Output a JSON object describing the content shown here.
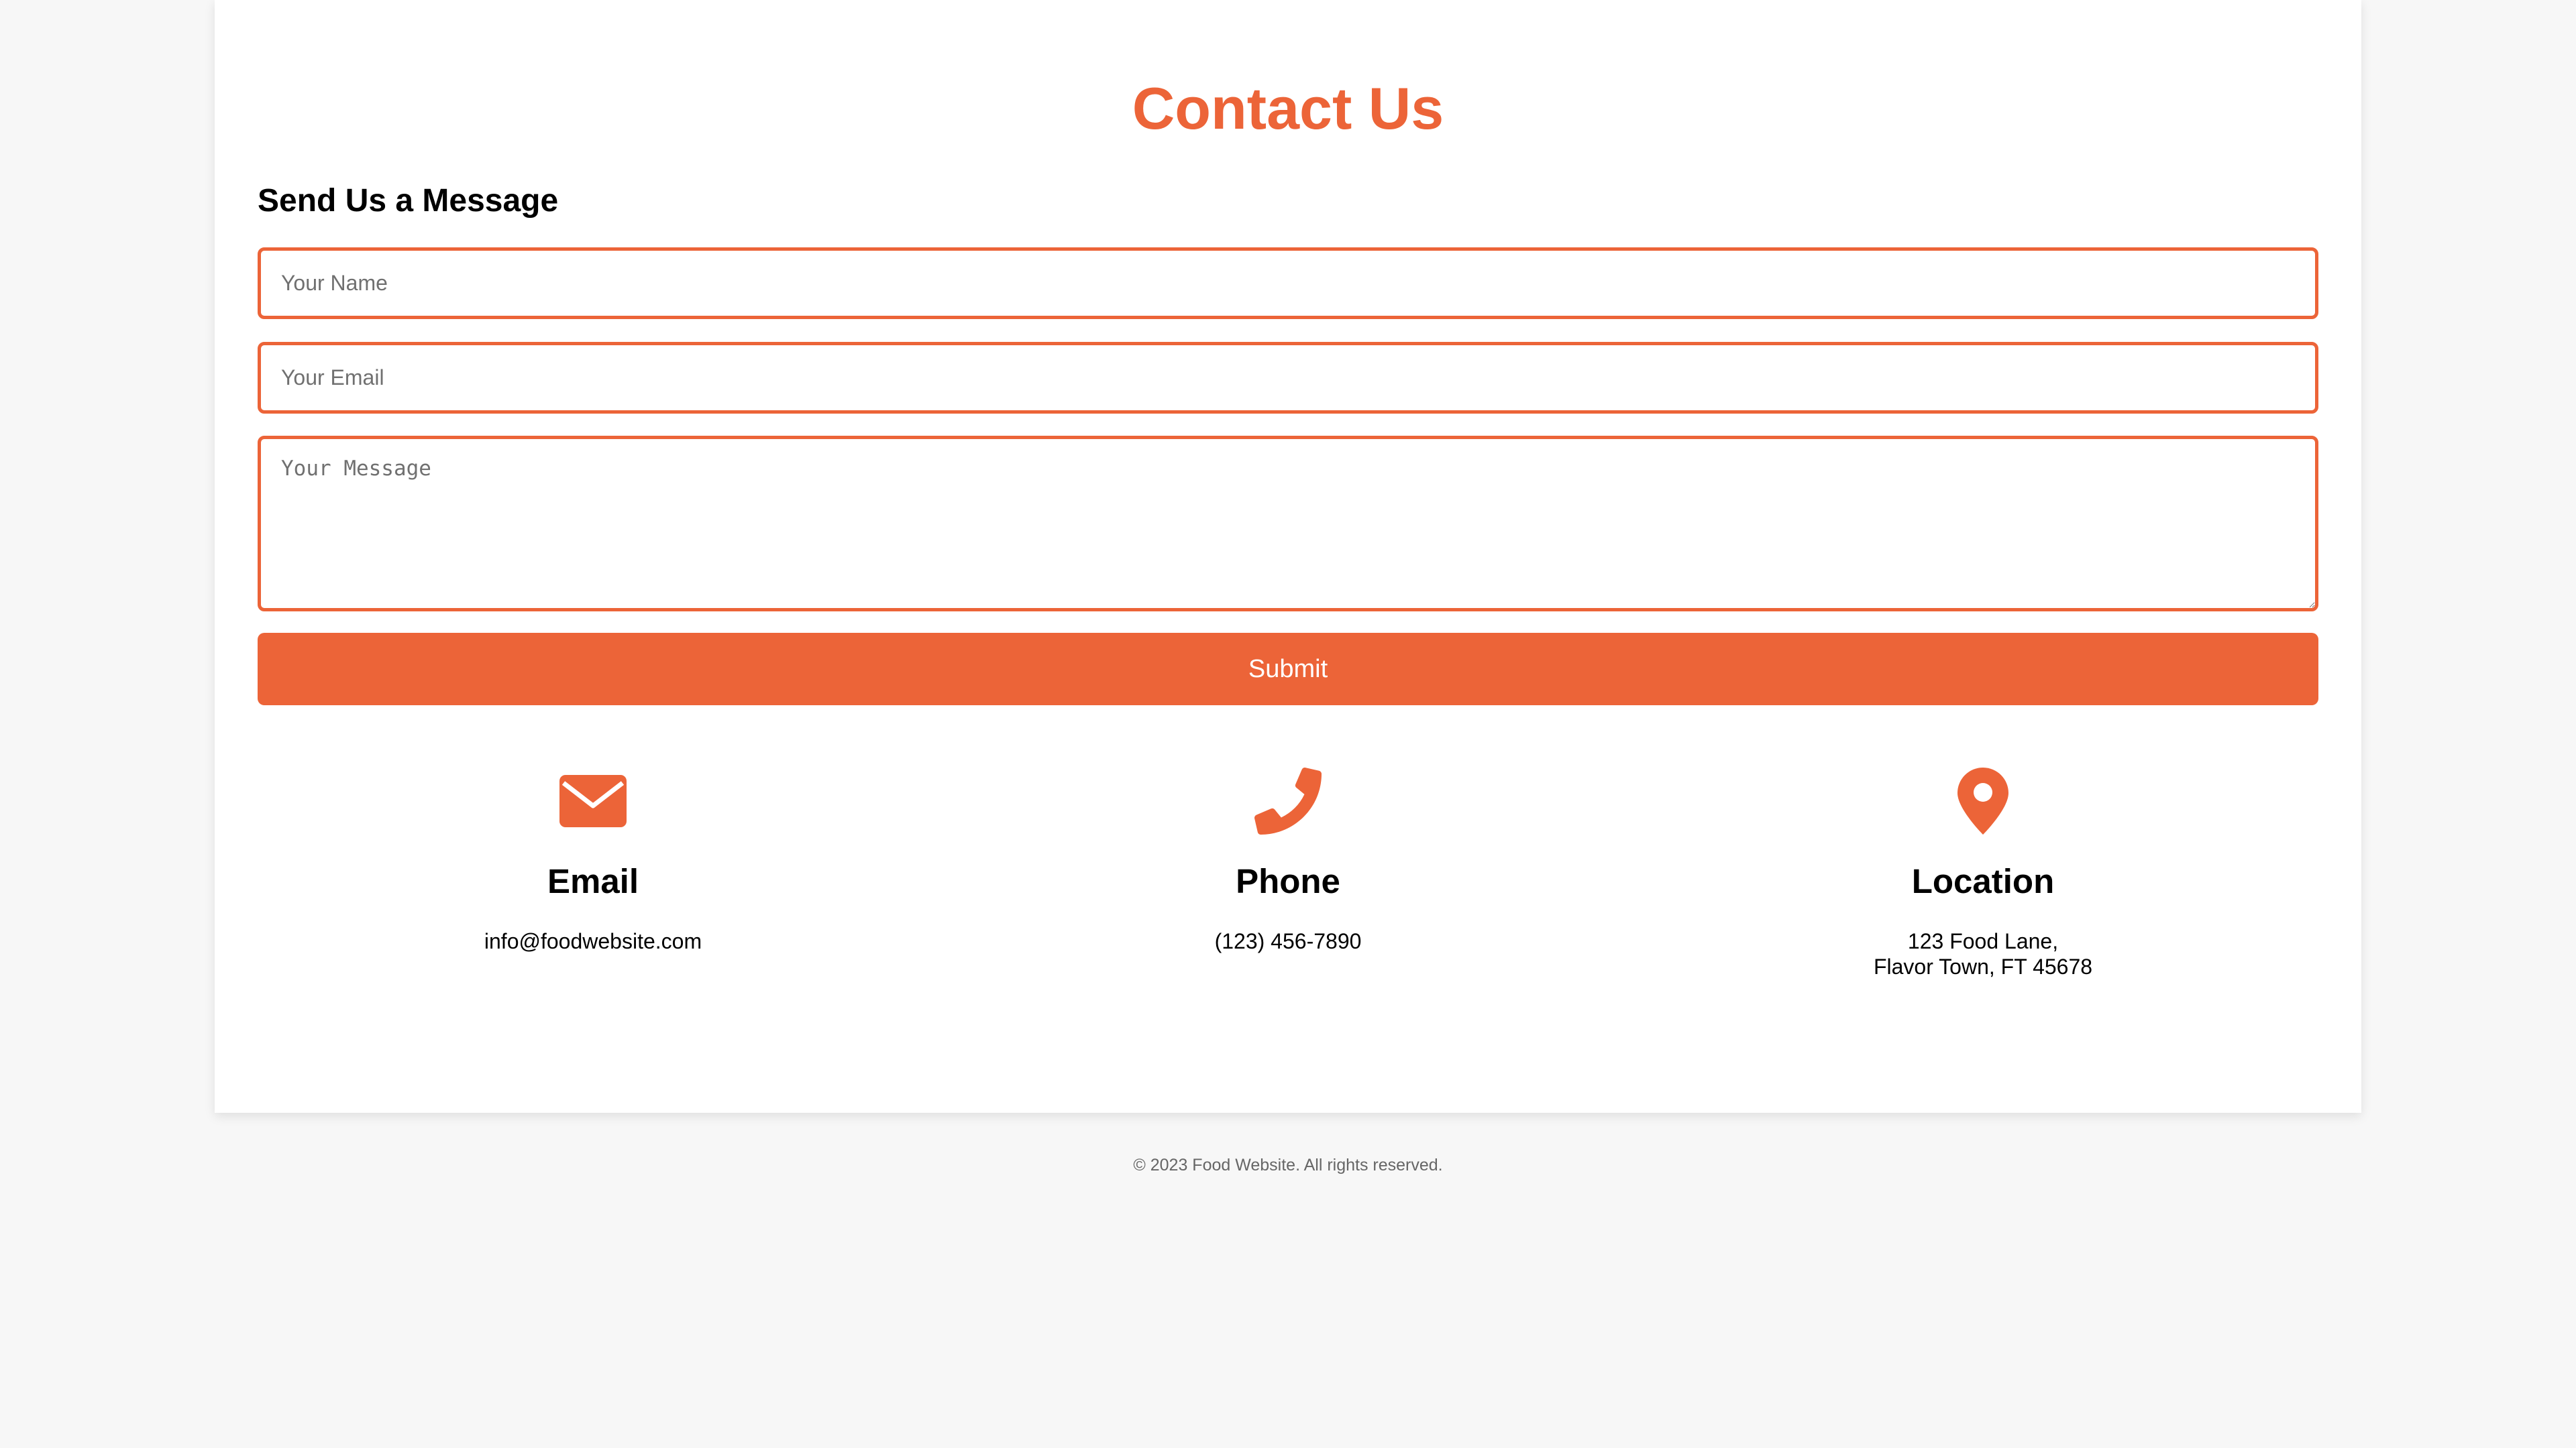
{
  "page": {
    "title": "Contact Us",
    "accent_color": "#ec6438",
    "background_color": "#f7f7f7"
  },
  "form": {
    "heading": "Send Us a Message",
    "name_placeholder": "Your Name",
    "email_placeholder": "Your Email",
    "message_placeholder": "Your Message",
    "name_value": "",
    "email_value": "",
    "message_value": "",
    "submit_label": "Submit"
  },
  "contact_info": {
    "email": {
      "icon": "envelope-icon",
      "title": "Email",
      "text": "info@foodwebsite.com"
    },
    "phone": {
      "icon": "phone-icon",
      "title": "Phone",
      "text": "(123) 456-7890"
    },
    "location": {
      "icon": "map-pin-icon",
      "title": "Location",
      "line1": "123 Food Lane,",
      "line2": "Flavor Town, FT 45678"
    }
  },
  "footer": {
    "copyright": "© 2023 Food Website. All rights reserved."
  }
}
